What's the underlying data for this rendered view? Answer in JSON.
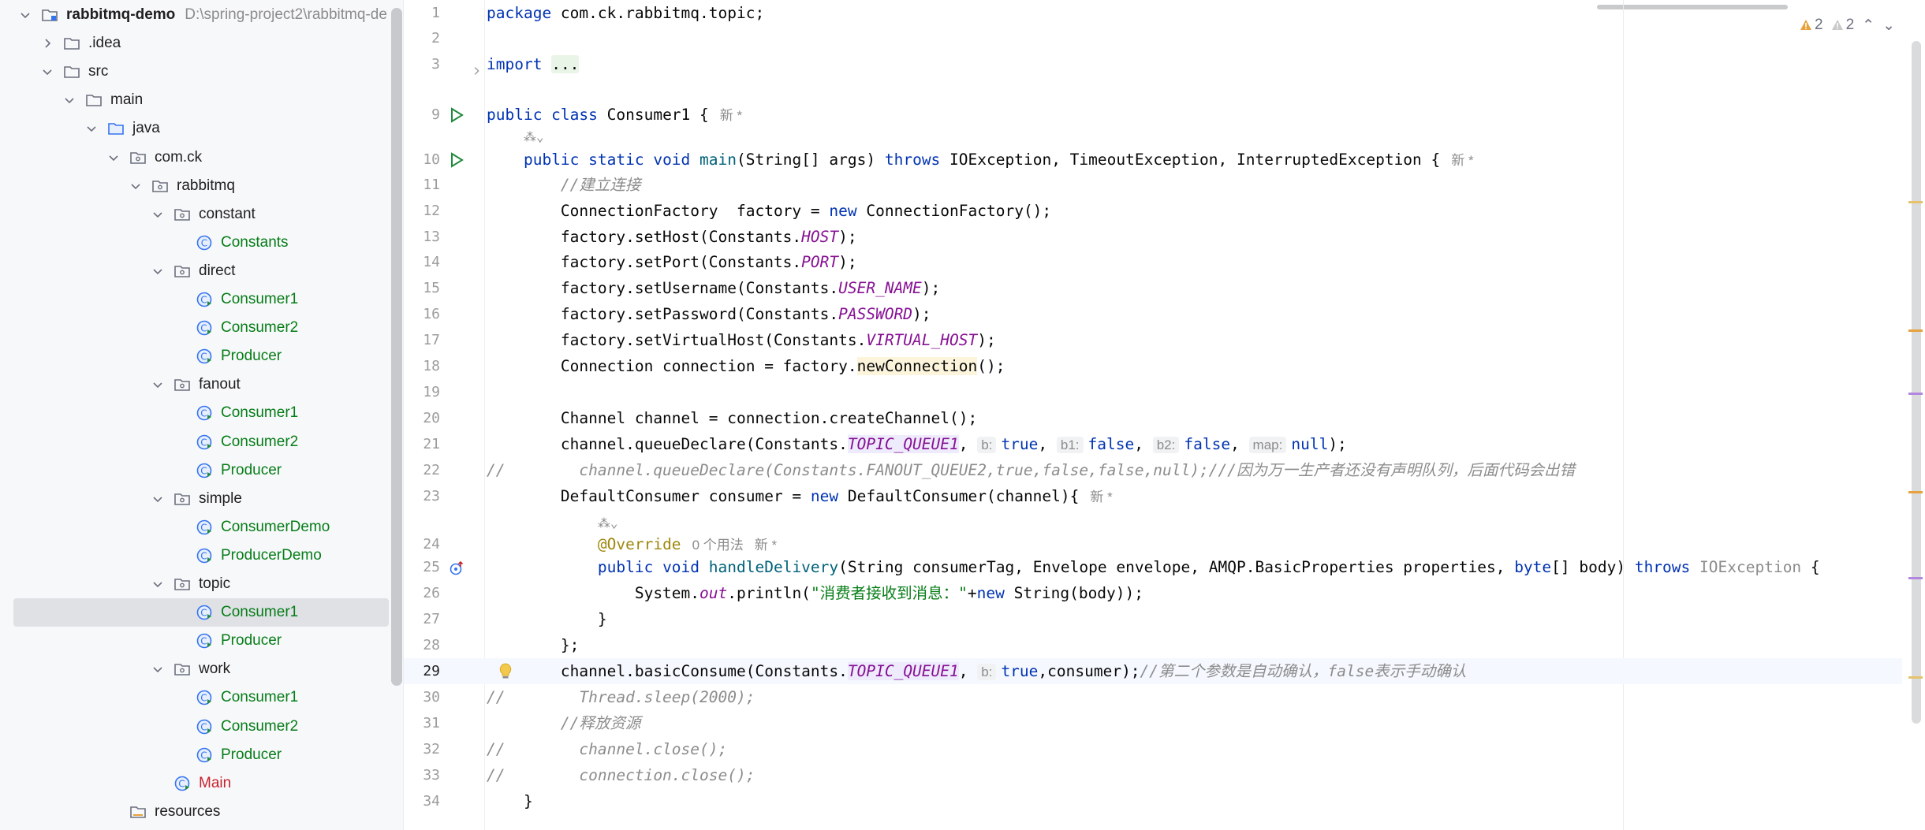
{
  "project_tree": {
    "root": {
      "label": "rabbitmq-demo",
      "path": "D:\\spring-project2\\rabbitmq-de"
    },
    "items": [
      {
        "label": "rabbitmq-demo",
        "level": 0,
        "chevron": "down",
        "icon": "module-icon",
        "color": "bold"
      },
      {
        "label": ".idea",
        "level": 1,
        "chevron": "right",
        "icon": "folder-icon"
      },
      {
        "label": "src",
        "level": 1,
        "chevron": "down",
        "icon": "folder-icon"
      },
      {
        "label": "main",
        "level": 2,
        "chevron": "down",
        "icon": "folder-icon"
      },
      {
        "label": "java",
        "level": 3,
        "chevron": "down",
        "icon": "source-folder-icon"
      },
      {
        "label": "com.ck",
        "level": 4,
        "chevron": "down",
        "icon": "package-icon"
      },
      {
        "label": "rabbitmq",
        "level": 5,
        "chevron": "down",
        "icon": "package-icon"
      },
      {
        "label": "constant",
        "level": 6,
        "chevron": "down",
        "icon": "package-icon"
      },
      {
        "label": "Constants",
        "level": 7,
        "chevron": "none",
        "icon": "class-icon",
        "color": "green"
      },
      {
        "label": "direct",
        "level": 6,
        "chevron": "down",
        "icon": "package-icon"
      },
      {
        "label": "Consumer1",
        "level": 7,
        "chevron": "none",
        "icon": "class-run-icon",
        "color": "green"
      },
      {
        "label": "Consumer2",
        "level": 7,
        "chevron": "none",
        "icon": "class-run-icon",
        "color": "green"
      },
      {
        "label": "Producer",
        "level": 7,
        "chevron": "none",
        "icon": "class-run-icon",
        "color": "green"
      },
      {
        "label": "fanout",
        "level": 6,
        "chevron": "down",
        "icon": "package-icon"
      },
      {
        "label": "Consumer1",
        "level": 7,
        "chevron": "none",
        "icon": "class-run-icon",
        "color": "green"
      },
      {
        "label": "Consumer2",
        "level": 7,
        "chevron": "none",
        "icon": "class-run-icon",
        "color": "green"
      },
      {
        "label": "Producer",
        "level": 7,
        "chevron": "none",
        "icon": "class-run-icon",
        "color": "green"
      },
      {
        "label": "simple",
        "level": 6,
        "chevron": "down",
        "icon": "package-icon"
      },
      {
        "label": "ConsumerDemo",
        "level": 7,
        "chevron": "none",
        "icon": "class-run-icon",
        "color": "green"
      },
      {
        "label": "ProducerDemo",
        "level": 7,
        "chevron": "none",
        "icon": "class-run-icon",
        "color": "green"
      },
      {
        "label": "topic",
        "level": 6,
        "chevron": "down",
        "icon": "package-icon"
      },
      {
        "label": "Consumer1",
        "level": 7,
        "chevron": "none",
        "icon": "class-run-icon",
        "color": "green",
        "selected": true
      },
      {
        "label": "Producer",
        "level": 7,
        "chevron": "none",
        "icon": "class-run-icon",
        "color": "green"
      },
      {
        "label": "work",
        "level": 6,
        "chevron": "down",
        "icon": "package-icon"
      },
      {
        "label": "Consumer1",
        "level": 7,
        "chevron": "none",
        "icon": "class-run-icon",
        "color": "green"
      },
      {
        "label": "Consumer2",
        "level": 7,
        "chevron": "none",
        "icon": "class-run-icon",
        "color": "green"
      },
      {
        "label": "Producer",
        "level": 7,
        "chevron": "none",
        "icon": "class-run-icon",
        "color": "green"
      },
      {
        "label": "Main",
        "level": 6,
        "chevron": "none",
        "icon": "class-run-icon",
        "color": "red"
      },
      {
        "label": "resources",
        "level": 4,
        "chevron": "none",
        "icon": "resources-folder-icon"
      }
    ]
  },
  "inspections": {
    "warnings_a": "2",
    "warnings_b": "2"
  },
  "editor": {
    "lines": [
      {
        "n": "1",
        "html": "<span class=\"kw\">package</span> com.ck.rabbitmq.topic;"
      },
      {
        "n": "2",
        "html": ""
      },
      {
        "n": "3",
        "html": "<span class=\"kw\">import</span> <span class=\"fold\">...</span>",
        "fold": true
      },
      {
        "n": "9",
        "html": "<span class=\"kw\">public class</span> Consumer1 {<span class=\"tag\">新 *</span>",
        "run": true
      },
      {
        "n": "",
        "html": "    <span class=\"ai-glyph\">⁂⌄</span>",
        "ai": true
      },
      {
        "n": "10",
        "html": "    <span class=\"kw\">public static void</span> <span class=\"mth\">main</span>(String[] args) <span class=\"kw\">throws</span> IOException, TimeoutException, InterruptedException {<span class=\"tag\">新 *</span>",
        "run": true
      },
      {
        "n": "11",
        "html": "        <span class=\"cm\">//建立连接</span>"
      },
      {
        "n": "12",
        "html": "        ConnectionFactory  factory = <span class=\"kw\">new</span> ConnectionFactory();"
      },
      {
        "n": "13",
        "html": "        factory.setHost(Constants.<span class=\"fld\">HOST</span>);"
      },
      {
        "n": "14",
        "html": "        factory.setPort(Constants.<span class=\"fld\">PORT</span>);"
      },
      {
        "n": "15",
        "html": "        factory.setUsername(Constants.<span class=\"fld\">USER_NAME</span>);"
      },
      {
        "n": "16",
        "html": "        factory.setPassword(Constants.<span class=\"fld\">PASSWORD</span>);"
      },
      {
        "n": "17",
        "html": "        factory.setVirtualHost(Constants.<span class=\"fld\">VIRTUAL_HOST</span>);"
      },
      {
        "n": "18",
        "html": "        Connection connection = factory.<span class=\"hl\">newConnection</span>();"
      },
      {
        "n": "19",
        "html": ""
      },
      {
        "n": "20",
        "html": "        Channel channel = connection.createChannel();"
      },
      {
        "n": "21",
        "html": "        channel.queueDeclare(Constants.<span class=\"fld-bg\">TOPIC_QUEUE1</span>, <span class=\"hint\">b:</span><span class=\"kw\">true</span>, <span class=\"hint\">b1:</span><span class=\"kw\">false</span>, <span class=\"hint\">b2:</span><span class=\"kw\">false</span>, <span class=\"hint\">map:</span><span class=\"kw\">null</span>);"
      },
      {
        "n": "22",
        "html": "<span class=\"cm\">//        channel.queueDeclare(Constants.FANOUT_QUEUE2,true,false,false,null);///因为万一生产者还没有声明队列，后面代码会出错</span>"
      },
      {
        "n": "23",
        "html": "        DefaultConsumer consumer = <span class=\"kw\">new</span> DefaultConsumer(channel){<span class=\"tag\">新 *</span>"
      },
      {
        "n": "",
        "html": "            <span class=\"ai-glyph\">⁂⌄</span>",
        "ai": true
      },
      {
        "n": "24",
        "html": "            <span class=\"ann\">@Override</span><span class=\"usage\">0 个用法</span><span class=\"tag\">新 *</span>"
      },
      {
        "n": "25",
        "html": "            <span class=\"kw\">public void</span> <span class=\"mth\">handleDelivery</span>(String consumerTag, Envelope envelope, AMQP.BasicProperties properties, <span class=\"kw\">byte</span>[] body) <span class=\"kw\">throws</span> <span class=\"grey\">IOException</span> {",
        "override": true
      },
      {
        "n": "26",
        "html": "                System.<span class=\"fld\">out</span>.println(<span class=\"str\">\"消费者接收到消息：\"</span>+<span class=\"kw\">new</span> String(body));"
      },
      {
        "n": "27",
        "html": "            }"
      },
      {
        "n": "28",
        "html": "        };"
      },
      {
        "n": "29",
        "html": "        channel.basicConsume(Constants.<span class=\"fld-bg\">TOPIC_QUEUE1</span>, <span class=\"hint\">b:</span><span class=\"kw\">true</span>,consumer);<span class=\"cm\">//第二个参数是自动确认，false表示手动确认</span>",
        "current": true,
        "bulb": true
      },
      {
        "n": "30",
        "html": "<span class=\"cm\">//        Thread.sleep(2000);</span>"
      },
      {
        "n": "31",
        "html": "        <span class=\"cm\">//释放资源</span>"
      },
      {
        "n": "32",
        "html": "<span class=\"cm\">//        channel.close();</span>"
      },
      {
        "n": "33",
        "html": "<span class=\"cm\">//        connection.close();</span>"
      },
      {
        "n": "34",
        "html": "    }"
      }
    ]
  },
  "colors": {
    "keyword": "#0033b3",
    "comment": "#8c8c8c",
    "field": "#871094",
    "string": "#067d17",
    "annotation": "#9e880d",
    "tree_green": "#067d17",
    "tree_red": "#c7222d",
    "warning": "#e6a23c"
  }
}
